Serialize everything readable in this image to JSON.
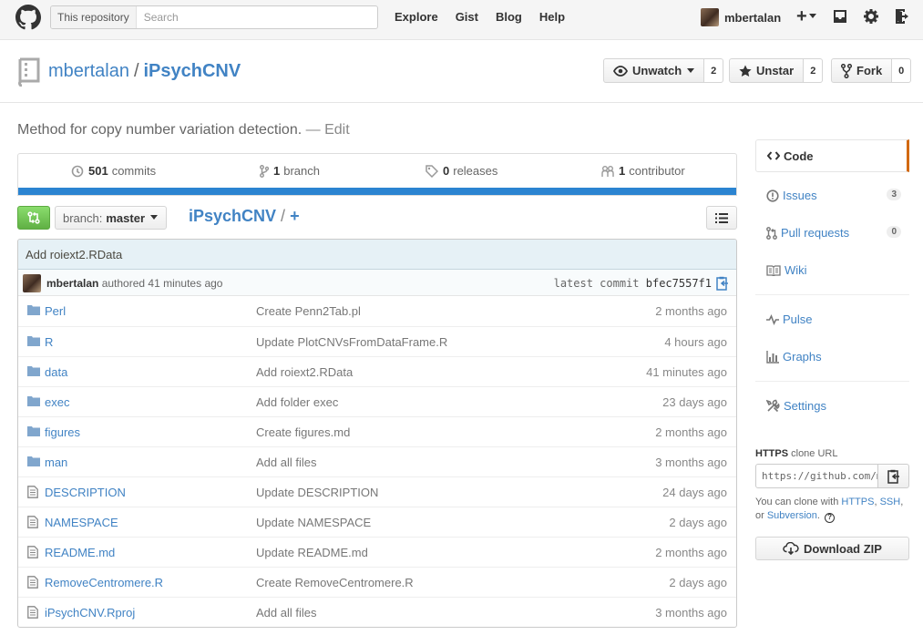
{
  "header": {
    "search_scope": "This repository",
    "search_placeholder": "Search",
    "nav": [
      "Explore",
      "Gist",
      "Blog",
      "Help"
    ],
    "username": "mbertalan",
    "plus_label": "+"
  },
  "repo": {
    "owner": "mbertalan",
    "separator": "/",
    "name": "iPsychCNV",
    "watch_label": "Unwatch",
    "watch_count": "2",
    "star_label": "Unstar",
    "star_count": "2",
    "fork_label": "Fork",
    "fork_count": "0"
  },
  "description": {
    "text": "Method for copy number variation detection.",
    "dash": " — ",
    "edit": "Edit"
  },
  "summary": {
    "commits_num": "501",
    "commits_label": "commits",
    "branches_num": "1",
    "branches_label": "branch",
    "releases_num": "0",
    "releases_label": "releases",
    "contributors_num": "1",
    "contributors_label": "contributor",
    "bar_color": "#2b84d1"
  },
  "file_nav": {
    "branch_prefix": "branch:",
    "branch_name": "master",
    "breadcrumb_repo": "iPsychCNV",
    "breadcrumb_sep": "/",
    "breadcrumb_add": "+"
  },
  "commit": {
    "message": "Add roiext2.RData",
    "author": "mbertalan",
    "authored_text": "authored 41 minutes ago",
    "latest_label": "latest commit",
    "sha": "bfec7557f1"
  },
  "files": [
    {
      "type": "dir",
      "name": "Perl",
      "message": "Create Penn2Tab.pl",
      "age": "2 months ago"
    },
    {
      "type": "dir",
      "name": "R",
      "message": "Update PlotCNVsFromDataFrame.R",
      "age": "4 hours ago"
    },
    {
      "type": "dir",
      "name": "data",
      "message": "Add roiext2.RData",
      "age": "41 minutes ago"
    },
    {
      "type": "dir",
      "name": "exec",
      "message": "Add folder exec",
      "age": "23 days ago"
    },
    {
      "type": "dir",
      "name": "figures",
      "message": "Create figures.md",
      "age": "2 months ago"
    },
    {
      "type": "dir",
      "name": "man",
      "message": "Add all files",
      "age": "3 months ago"
    },
    {
      "type": "file",
      "name": "DESCRIPTION",
      "message": "Update DESCRIPTION",
      "age": "24 days ago"
    },
    {
      "type": "file",
      "name": "NAMESPACE",
      "message": "Update NAMESPACE",
      "age": "2 days ago"
    },
    {
      "type": "file",
      "name": "README.md",
      "message": "Update README.md",
      "age": "2 months ago"
    },
    {
      "type": "file",
      "name": "RemoveCentromere.R",
      "message": "Create RemoveCentromere.R",
      "age": "2 days ago"
    },
    {
      "type": "file",
      "name": "iPsychCNV.Rproj",
      "message": "Add all files",
      "age": "3 months ago"
    }
  ],
  "sidebar": {
    "code": "Code",
    "issues": "Issues",
    "issues_count": "3",
    "pulls": "Pull requests",
    "pulls_count": "0",
    "wiki": "Wiki",
    "pulse": "Pulse",
    "graphs": "Graphs",
    "settings": "Settings",
    "selected_color": "#d26911"
  },
  "clone": {
    "protocol": "HTTPS",
    "label": "clone URL",
    "url": "https://github.com/mbertalan/iPsychCNV.git",
    "help_prefix": "You can clone with",
    "https": "HTTPS",
    "comma": ",",
    "ssh": "SSH",
    "or": ", or",
    "subversion": "Subversion",
    "period": ".",
    "help_icon": "?",
    "download_zip": "Download ZIP"
  }
}
